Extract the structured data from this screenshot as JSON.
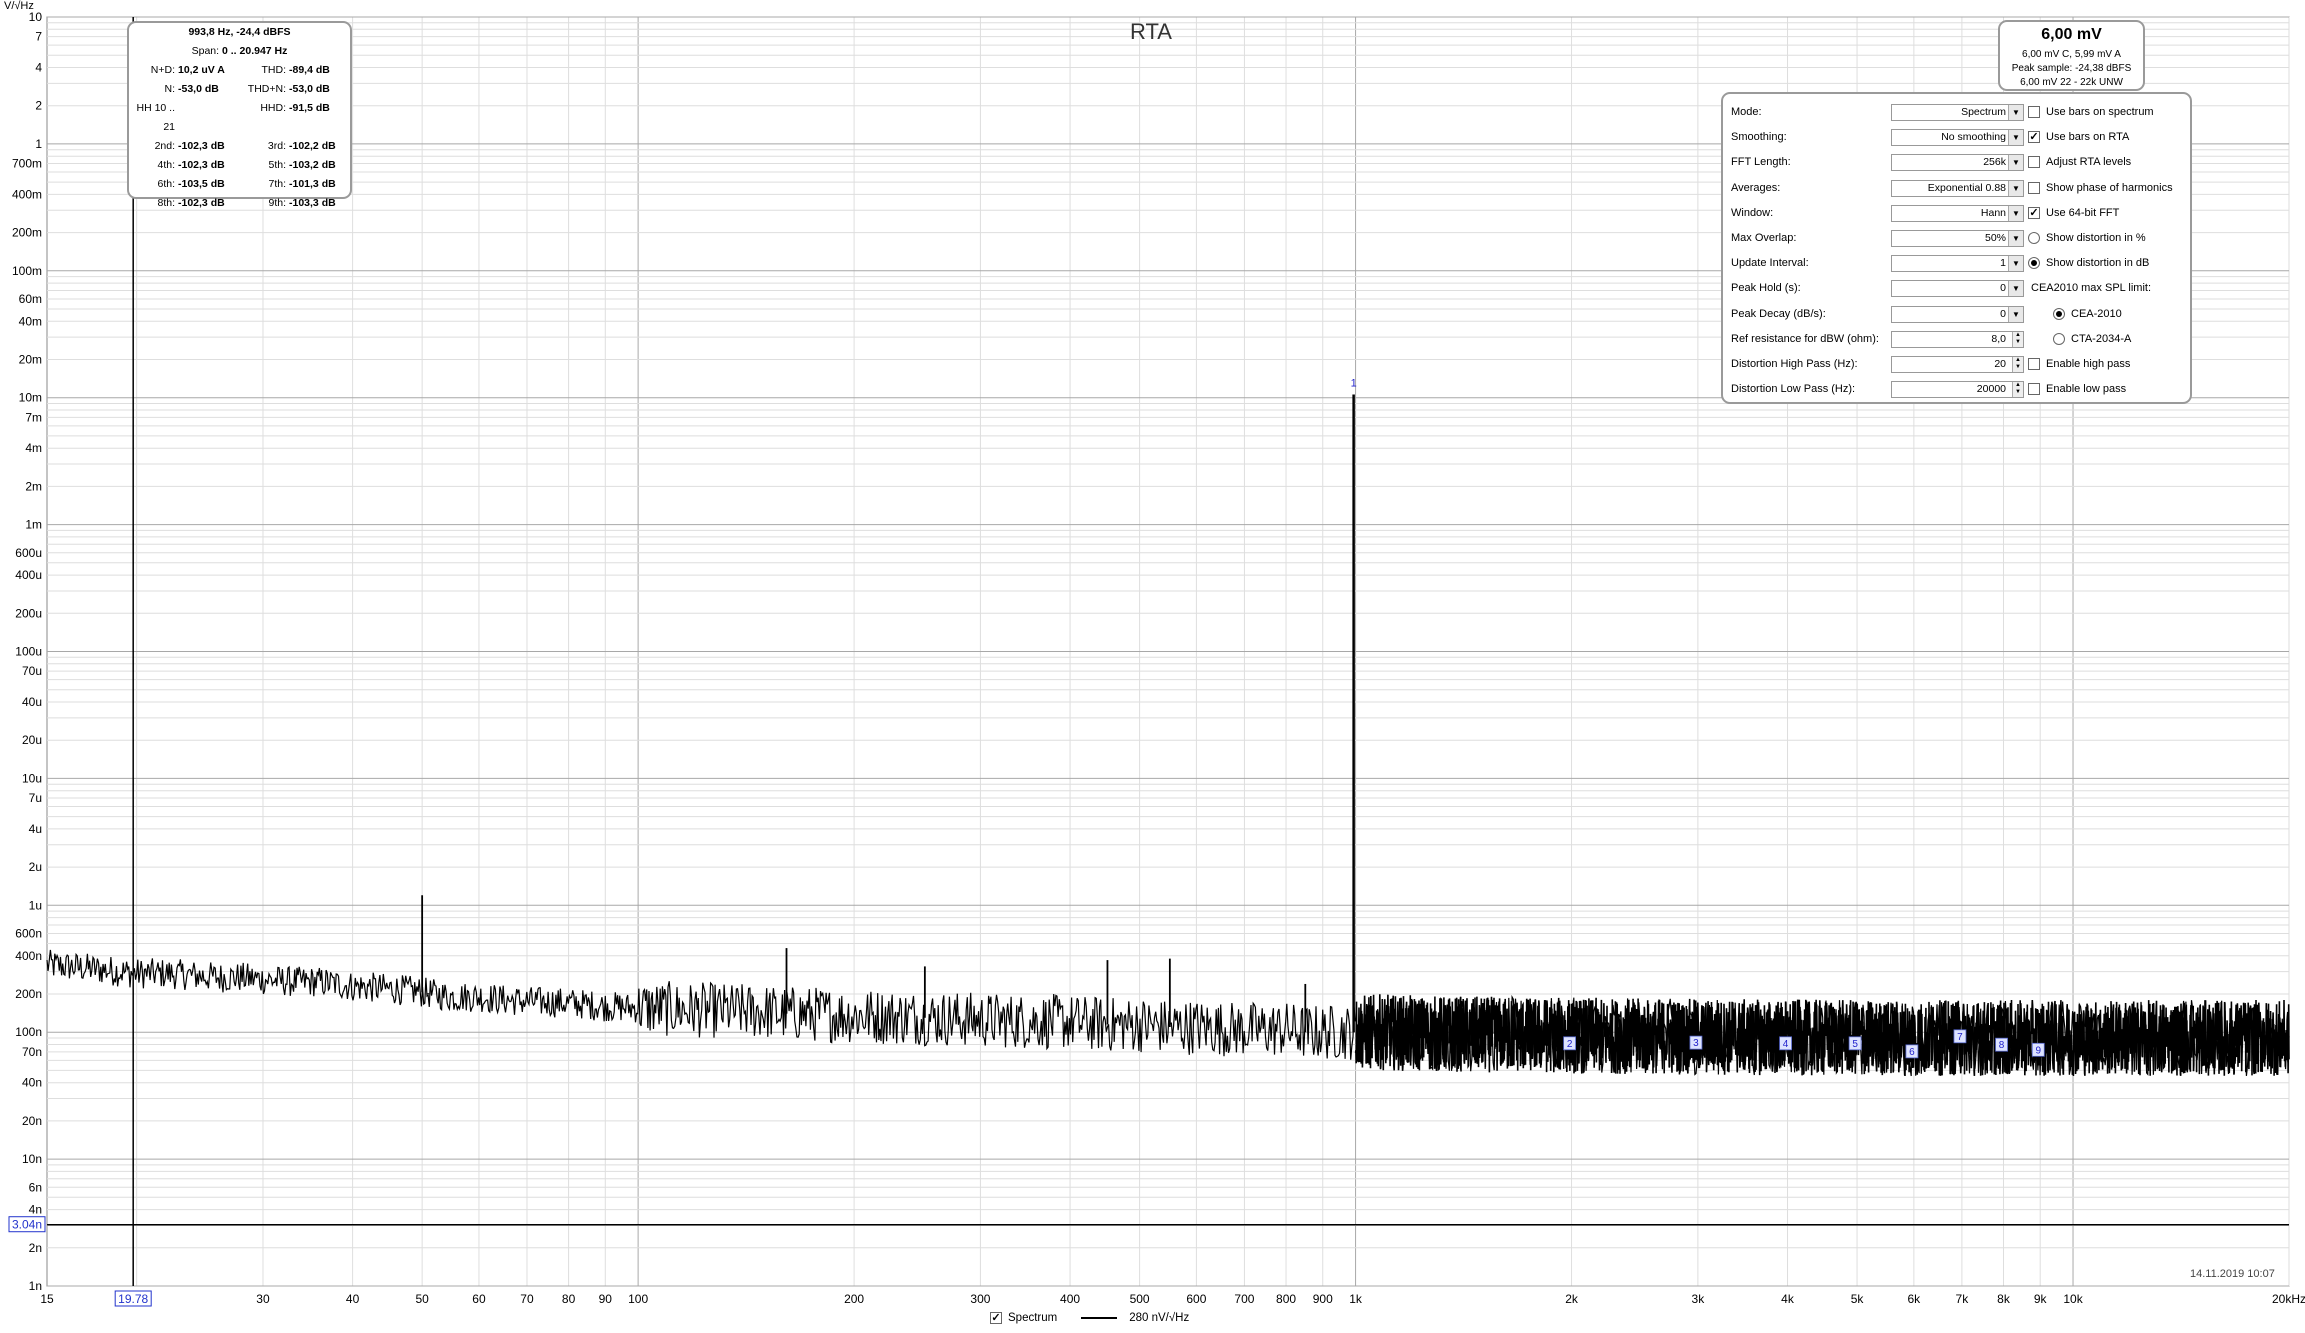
{
  "chart_data": {
    "type": "line",
    "title": "RTA",
    "ylabel": "V/√Hz",
    "xscale": "log",
    "yscale": "log",
    "xlim": [
      15,
      20000
    ],
    "ylim": [
      1e-09,
      10
    ],
    "x_ticks": [
      {
        "v": 15,
        "label": "15"
      },
      {
        "v": 30,
        "label": "30"
      },
      {
        "v": 40,
        "label": "40"
      },
      {
        "v": 50,
        "label": "50"
      },
      {
        "v": 60,
        "label": "60"
      },
      {
        "v": 70,
        "label": "70"
      },
      {
        "v": 80,
        "label": "80"
      },
      {
        "v": 90,
        "label": "90"
      },
      {
        "v": 100,
        "label": "100"
      },
      {
        "v": 200,
        "label": "200"
      },
      {
        "v": 300,
        "label": "300"
      },
      {
        "v": 400,
        "label": "400"
      },
      {
        "v": 500,
        "label": "500"
      },
      {
        "v": 600,
        "label": "600"
      },
      {
        "v": 700,
        "label": "700"
      },
      {
        "v": 800,
        "label": "800"
      },
      {
        "v": 900,
        "label": "900"
      },
      {
        "v": 1000,
        "label": "1k"
      },
      {
        "v": 2000,
        "label": "2k"
      },
      {
        "v": 3000,
        "label": "3k"
      },
      {
        "v": 4000,
        "label": "4k"
      },
      {
        "v": 5000,
        "label": "5k"
      },
      {
        "v": 6000,
        "label": "6k"
      },
      {
        "v": 7000,
        "label": "7k"
      },
      {
        "v": 8000,
        "label": "8k"
      },
      {
        "v": 9000,
        "label": "9k"
      },
      {
        "v": 10000,
        "label": "10k"
      },
      {
        "v": 20000,
        "label": "20kHz"
      }
    ],
    "y_ticks": [
      {
        "v": 10,
        "label": "10"
      },
      {
        "v": 7,
        "label": "7"
      },
      {
        "v": 4,
        "label": "4"
      },
      {
        "v": 2,
        "label": "2"
      },
      {
        "v": 1,
        "label": "1"
      },
      {
        "v": 0.7,
        "label": "700m"
      },
      {
        "v": 0.4,
        "label": "400m"
      },
      {
        "v": 0.2,
        "label": "200m"
      },
      {
        "v": 0.1,
        "label": "100m"
      },
      {
        "v": 0.06,
        "label": "60m"
      },
      {
        "v": 0.04,
        "label": "40m"
      },
      {
        "v": 0.02,
        "label": "20m"
      },
      {
        "v": 0.01,
        "label": "10m"
      },
      {
        "v": 0.007,
        "label": "7m"
      },
      {
        "v": 0.004,
        "label": "4m"
      },
      {
        "v": 0.002,
        "label": "2m"
      },
      {
        "v": 0.001,
        "label": "1m"
      },
      {
        "v": 0.0006,
        "label": "600u"
      },
      {
        "v": 0.0004,
        "label": "400u"
      },
      {
        "v": 0.0002,
        "label": "200u"
      },
      {
        "v": 0.0001,
        "label": "100u"
      },
      {
        "v": 7e-05,
        "label": "70u"
      },
      {
        "v": 4e-05,
        "label": "40u"
      },
      {
        "v": 2e-05,
        "label": "20u"
      },
      {
        "v": 1e-05,
        "label": "10u"
      },
      {
        "v": 7e-06,
        "label": "7u"
      },
      {
        "v": 4e-06,
        "label": "4u"
      },
      {
        "v": 2e-06,
        "label": "2u"
      },
      {
        "v": 1e-06,
        "label": "1u"
      },
      {
        "v": 6e-07,
        "label": "600n"
      },
      {
        "v": 4e-07,
        "label": "400n"
      },
      {
        "v": 2e-07,
        "label": "200n"
      },
      {
        "v": 1e-07,
        "label": "100n"
      },
      {
        "v": 7e-08,
        "label": "70n"
      },
      {
        "v": 4e-08,
        "label": "40n"
      },
      {
        "v": 2e-08,
        "label": "20n"
      },
      {
        "v": 1e-08,
        "label": "10n"
      },
      {
        "v": 6e-09,
        "label": "6n"
      },
      {
        "v": 4e-09,
        "label": "4n"
      },
      {
        "v": 2e-09,
        "label": "2n"
      },
      {
        "v": 1e-09,
        "label": "1n"
      }
    ],
    "grid": true,
    "series": [
      {
        "name": "Spectrum",
        "x": [
          15,
          16,
          17,
          18,
          19,
          20,
          22,
          24,
          26,
          28,
          30,
          33,
          36,
          40,
          45,
          49,
          50,
          51,
          55,
          60,
          65,
          70,
          80,
          90,
          100,
          120,
          150,
          160,
          161,
          170,
          200,
          250,
          251,
          300,
          400,
          450,
          451,
          500,
          550,
          551,
          600,
          700,
          800,
          850,
          851,
          900,
          960,
          993.8,
          1030,
          1100,
          1200,
          1500,
          2000,
          2500,
          3000,
          4000,
          5000,
          6000,
          7000,
          8000,
          9000,
          10000,
          12000,
          15000,
          18000,
          20000
        ],
        "y": [
          3.4e-07,
          3.3e-07,
          3.2e-07,
          3.1e-07,
          3e-07,
          2.9e-07,
          2.9e-07,
          2.8e-07,
          2.7e-07,
          2.7e-07,
          2.6e-07,
          2.5e-07,
          2.5e-07,
          2.3e-07,
          2.2e-07,
          2.1e-07,
          1.2e-06,
          2e-07,
          1.9e-07,
          1.9e-07,
          1.8e-07,
          1.75e-07,
          1.7e-07,
          1.6e-07,
          1.55e-07,
          1.5e-07,
          1.45e-07,
          1.4e-07,
          4.6e-07,
          1.4e-07,
          1.35e-07,
          1.3e-07,
          3.3e-07,
          1.25e-07,
          1.2e-07,
          1.15e-07,
          3.7e-07,
          1.15e-07,
          1.1e-07,
          3.8e-07,
          1.1e-07,
          1.05e-07,
          1.05e-07,
          1e-07,
          2.4e-07,
          1e-07,
          1e-07,
          0.0106,
          1e-07,
          1e-07,
          9.8e-08,
          9.6e-08,
          9.4e-08,
          9.3e-08,
          9.2e-08,
          9.1e-08,
          9e-08,
          9e-08,
          9e-08,
          9e-08,
          9e-08,
          9e-08,
          9e-08,
          9e-08,
          9e-08,
          9e-08
        ]
      }
    ],
    "harmonic_markers": [
      {
        "label": "1",
        "x": 993.8,
        "y": 0.0106
      },
      {
        "label": "2",
        "x": 1987.6,
        "y": 8.1e-08
      },
      {
        "label": "3",
        "x": 2981.4,
        "y": 8.2e-08
      },
      {
        "label": "4",
        "x": 3975.2,
        "y": 8.1e-08
      },
      {
        "label": "5",
        "x": 4969,
        "y": 8.1e-08
      },
      {
        "label": "6",
        "x": 5962.8,
        "y": 7e-08
      },
      {
        "label": "7",
        "x": 6956.6,
        "y": 9.2e-08
      },
      {
        "label": "8",
        "x": 7950.4,
        "y": 7.9e-08
      },
      {
        "label": "9",
        "x": 8944.2,
        "y": 7.2e-08
      }
    ],
    "cursor_x": {
      "value": 19.78,
      "label": "19.78"
    },
    "cursor_y": {
      "value": 3.04e-09,
      "label": "3.04n"
    },
    "legend": [
      {
        "label": "Spectrum",
        "checked": true
      },
      {
        "label": "280 nV/√Hz"
      }
    ],
    "legend_position": "bottom"
  },
  "stats": {
    "header": "993,8 Hz, -24,4 dBFS",
    "span_label": "Span:",
    "span_value": "0 .. 20.947 Hz",
    "rows": [
      {
        "l1": "N+D:",
        "v1": "10,2 uV A",
        "l2": "THD:",
        "v2": "-89,4 dB"
      },
      {
        "l1": "N:",
        "v1": "-53,0 dB",
        "l2": "THD+N:",
        "v2": "-53,0 dB"
      },
      {
        "l1": "HH 10 .. 21",
        "v1": "",
        "l2": "HHD:",
        "v2": "-91,5 dB"
      },
      {
        "l1": "2nd:",
        "v1": "-102,3 dB",
        "l2": "3rd:",
        "v2": "-102,2 dB"
      },
      {
        "l1": "4th:",
        "v1": "-102,3 dB",
        "l2": "5th:",
        "v2": "-103,2 dB"
      },
      {
        "l1": "6th:",
        "v1": "-103,5 dB",
        "l2": "7th:",
        "v2": "-101,3 dB"
      },
      {
        "l1": "8th:",
        "v1": "-102,3 dB",
        "l2": "9th:",
        "v2": "-103,3 dB"
      }
    ]
  },
  "level": {
    "main": "6,00 mV",
    "line1": "6,00 mV C, 5,99 mV A",
    "line2": "Peak sample: -24,38 dBFS",
    "line3": "6,00 mV 22 - 22k UNW"
  },
  "settings": {
    "rows": [
      {
        "label": "Mode:",
        "value": "Spectrum",
        "ctrl": "drop"
      },
      {
        "label": "Smoothing:",
        "value": "No  smoothing",
        "ctrl": "drop"
      },
      {
        "label": "FFT Length:",
        "value": "256k",
        "ctrl": "drop"
      },
      {
        "label": "Averages:",
        "value": "Exponential 0.88",
        "ctrl": "drop"
      },
      {
        "label": "Window:",
        "value": "Hann",
        "ctrl": "drop"
      },
      {
        "label": "Max Overlap:",
        "value": "50%",
        "ctrl": "drop"
      },
      {
        "label": "Update Interval:",
        "value": "1",
        "ctrl": "drop"
      },
      {
        "label": "Peak Hold (s):",
        "value": "0",
        "ctrl": "drop"
      },
      {
        "label": "Peak Decay (dB/s):",
        "value": "0",
        "ctrl": "drop"
      },
      {
        "label": "Ref resistance for dBW (ohm):",
        "value": "8,0",
        "ctrl": "spin"
      },
      {
        "label": "Distortion High Pass (Hz):",
        "value": "20",
        "ctrl": "spin"
      },
      {
        "label": "Distortion Low Pass (Hz):",
        "value": "20000",
        "ctrl": "spin"
      }
    ],
    "options": [
      {
        "label": "Use bars on spectrum",
        "kind": "check",
        "on": false
      },
      {
        "label": "Use bars on RTA",
        "kind": "check",
        "on": true
      },
      {
        "label": "Adjust RTA levels",
        "kind": "check",
        "on": false
      },
      {
        "label": "Show phase of harmonics",
        "kind": "check",
        "on": false
      },
      {
        "label": "Use 64-bit FFT",
        "kind": "check",
        "on": true
      },
      {
        "label": "Show distortion in %",
        "kind": "radio",
        "on": false
      },
      {
        "label": "Show distortion in dB",
        "kind": "radio",
        "on": true
      },
      {
        "label": "CEA2010 max SPL limit:",
        "kind": "text",
        "on": false
      },
      {
        "label": "CEA-2010",
        "kind": "radio-indent",
        "on": true
      },
      {
        "label": "CTA-2034-A",
        "kind": "radio-indent",
        "on": false
      },
      {
        "label": "Enable high pass",
        "kind": "check",
        "on": false
      },
      {
        "label": "Enable low pass",
        "kind": "check",
        "on": false
      }
    ]
  },
  "timestamp": "14.11.2019 10:07"
}
